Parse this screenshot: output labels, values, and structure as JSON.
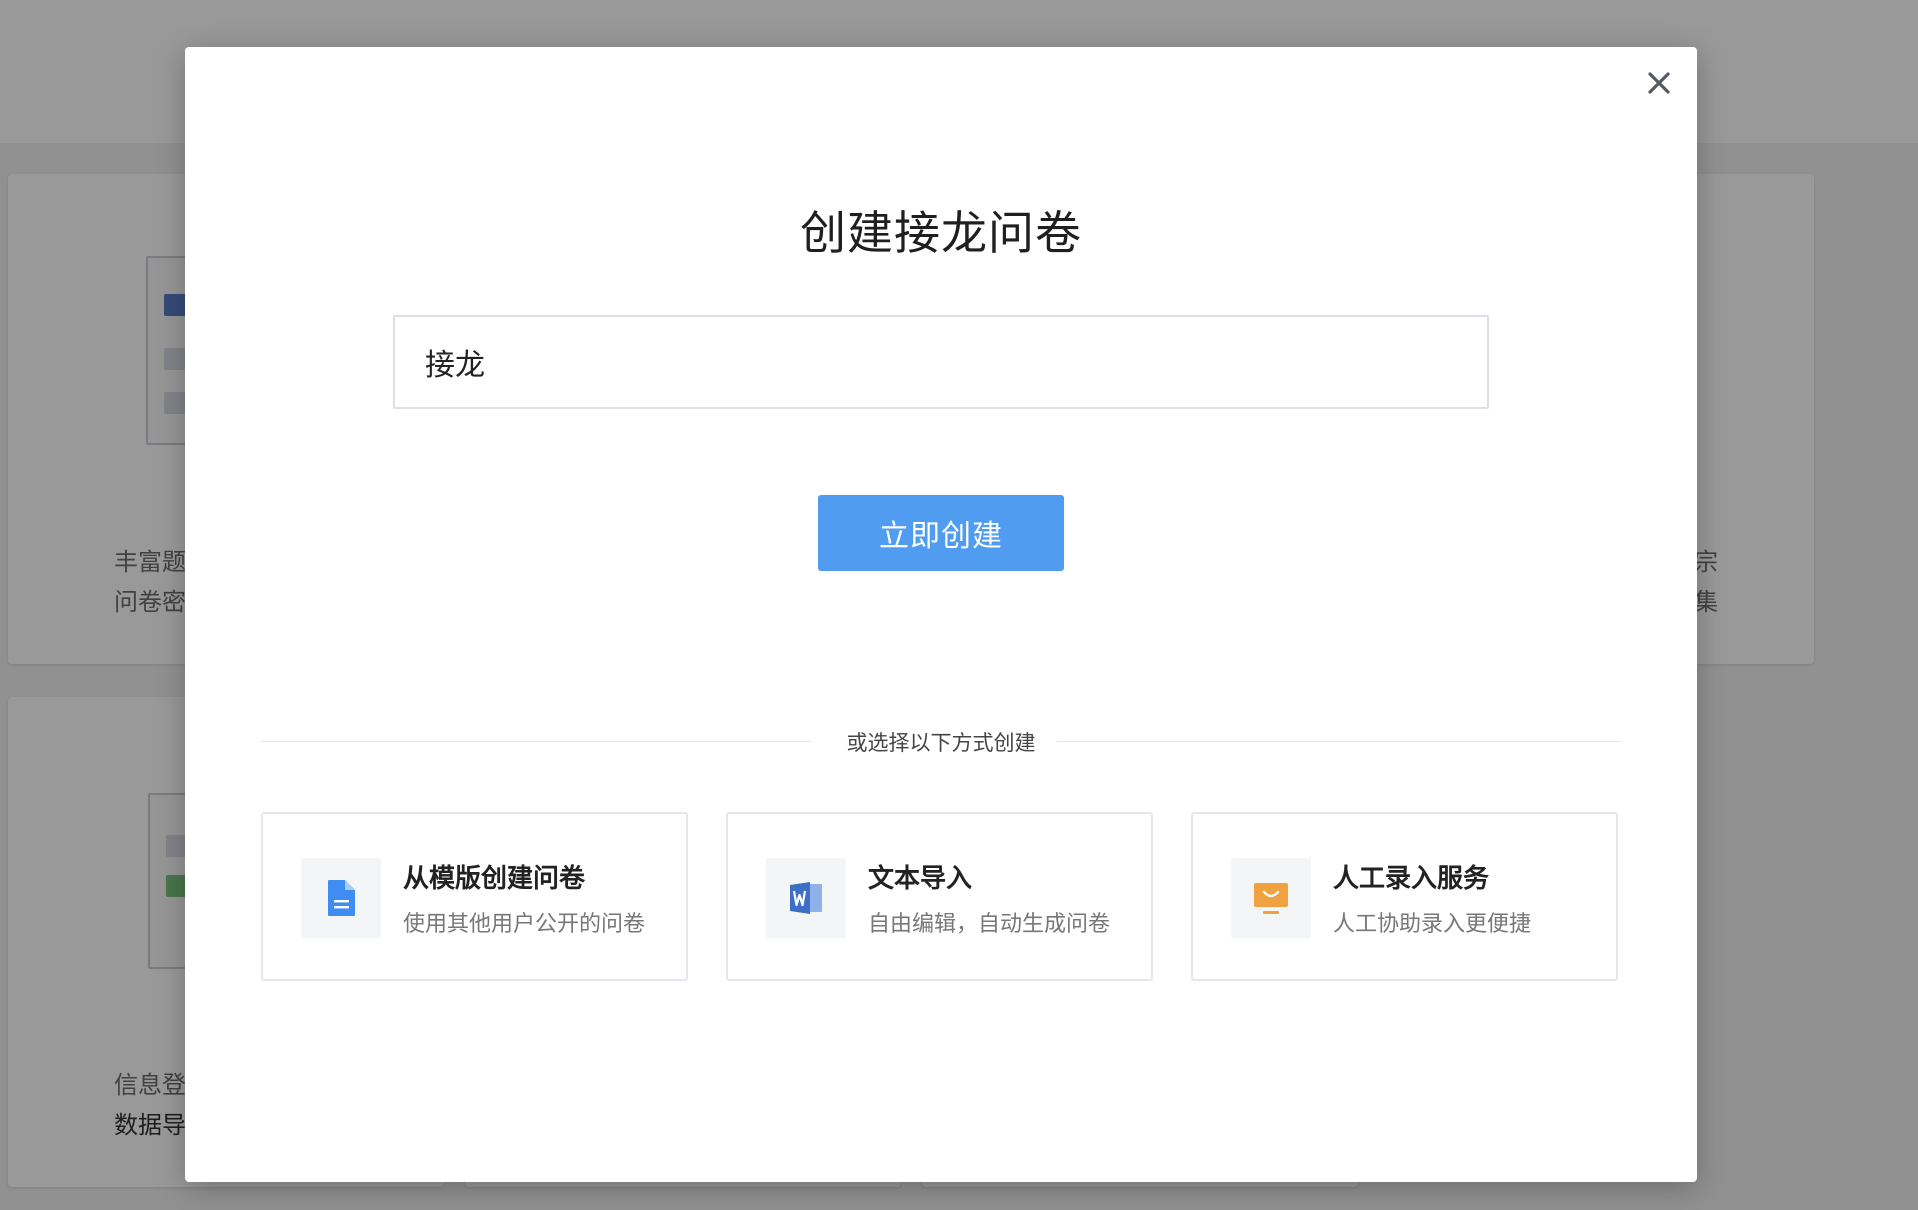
{
  "background": {
    "card1_lines": [
      "丰富题",
      "问卷密"
    ],
    "card2_lines": [
      "信息登",
      "数据导"
    ],
    "right_fragments": [
      "宗",
      "集"
    ]
  },
  "modal": {
    "title": "创建接龙问卷",
    "input_value": "接龙",
    "create_button": "立即创建",
    "divider_text": "或选择以下方式创建",
    "options": [
      {
        "title": "从模版创建问卷",
        "desc": "使用其他用户公开的问卷",
        "icon": "document-icon",
        "color": "#3f8cf2"
      },
      {
        "title": "文本导入",
        "desc": "自由编辑，自动生成问卷",
        "icon": "word-icon",
        "color": "#3d6fc7"
      },
      {
        "title": "人工录入服务",
        "desc": "人工协助录入更便捷",
        "icon": "monitor-icon",
        "color": "#f0a140"
      }
    ]
  }
}
